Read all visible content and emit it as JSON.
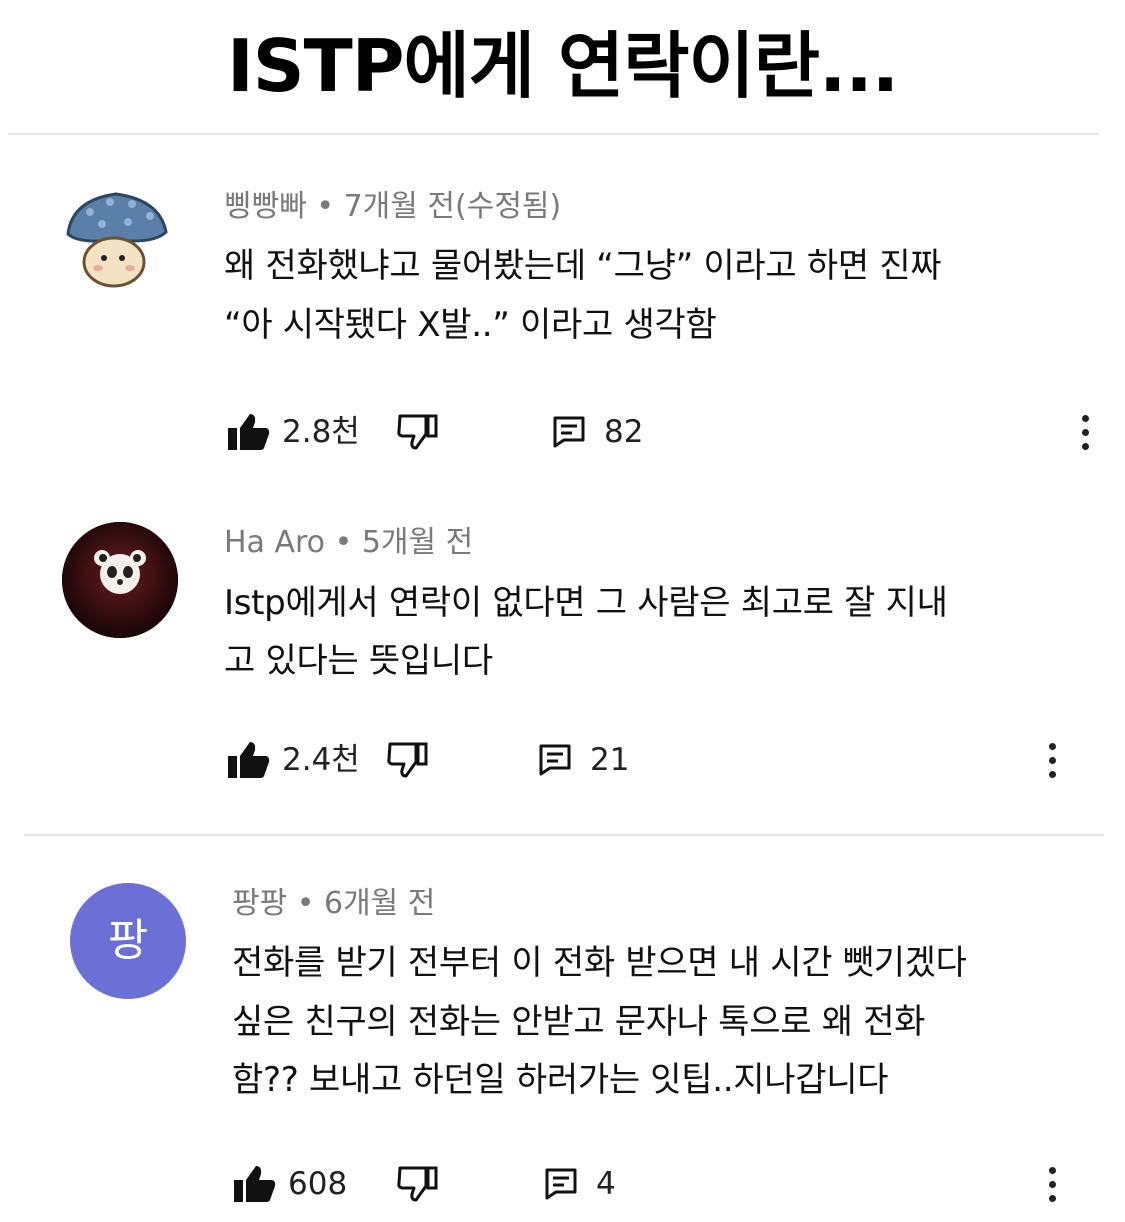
{
  "title": "ISTP에게 연락이란...",
  "comments": [
    {
      "author": "삥빵빠",
      "time": "7개월 전(수정됨)",
      "lines": [
        "왜 전화했냐고 물어봤는데 “그냥” 이라고 하면 진짜",
        "“아 시작됐다 X발..” 이라고 생각함"
      ],
      "likes": "2.8천",
      "replies": "82",
      "avatar_icon": "mushroom-icon"
    },
    {
      "author": "Ha Aro",
      "time": "5개월 전",
      "lines": [
        "Istp에게서 연락이 없다면 그 사람은 최고로 잘 지내",
        "고 있다는 뜻입니다"
      ],
      "likes": "2.4천",
      "replies": "21",
      "avatar_icon": "panda-icon"
    },
    {
      "author": "팡팡",
      "time": "6개월 전",
      "lines": [
        "전화를 받기 전부터 이 전화 받으면 내 시간 뺏기겠다",
        "싶은 친구의 전화는 안받고 문자나 톡으로 왜 전화",
        "함?? 보내고 하던일 하러가는 잇팁..지나갑니다"
      ],
      "likes": "608",
      "replies": "4",
      "avatar_letter": "팡",
      "avatar_color": "#6b6fd6"
    }
  ],
  "colors": {
    "meta": "#7a7a7a",
    "text": "#111111"
  }
}
